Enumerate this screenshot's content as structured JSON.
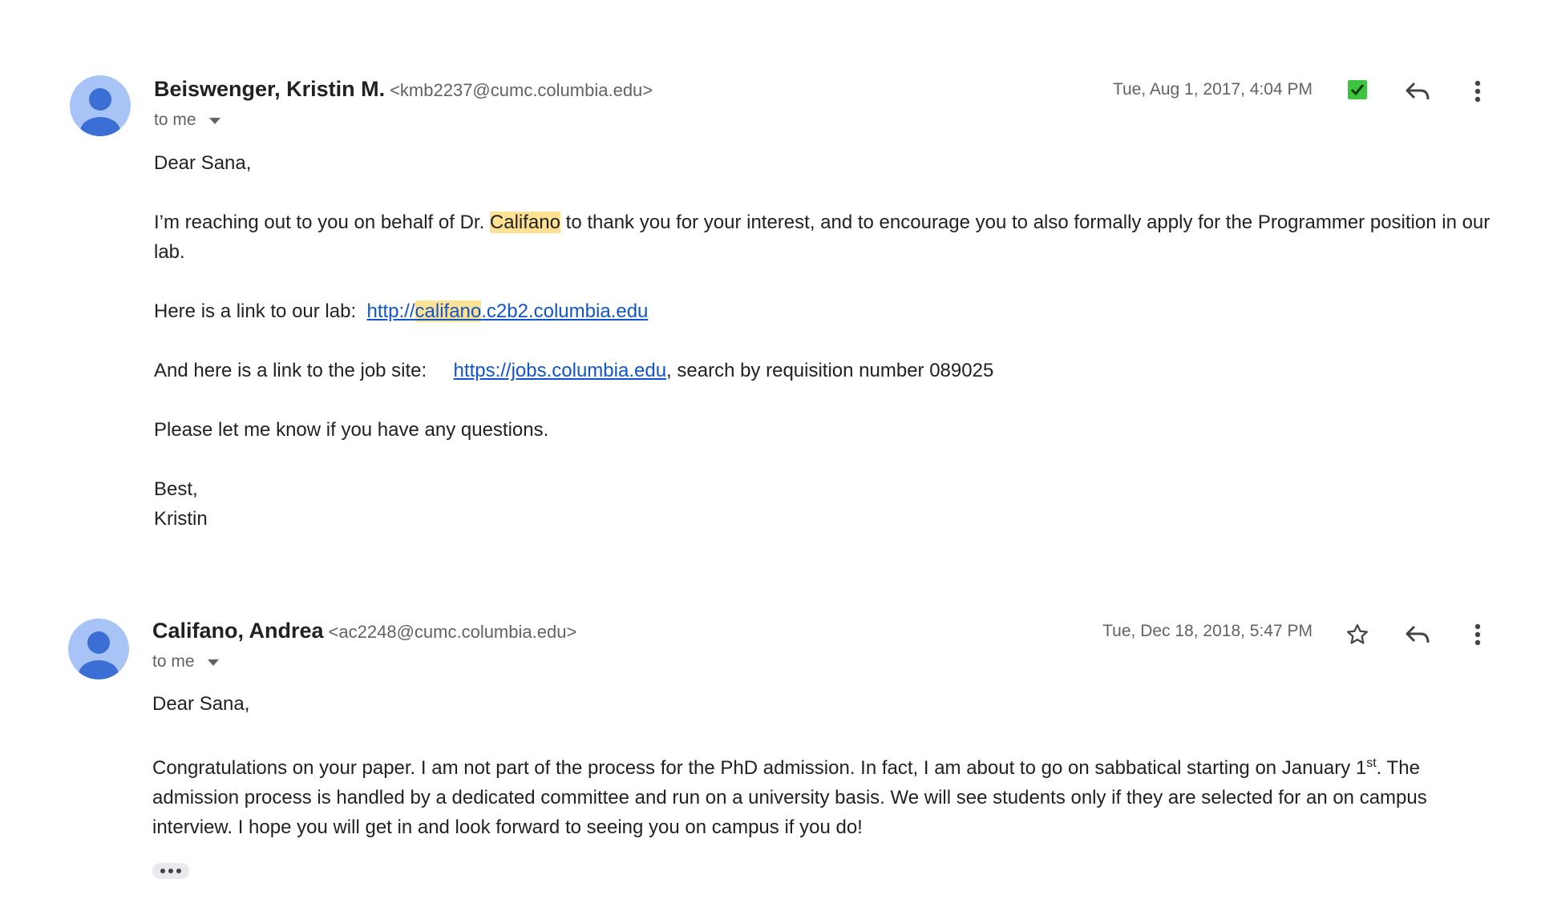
{
  "messages": [
    {
      "sender_name": "Beiswenger, Kristin M.",
      "sender_email": "<kmb2237@cumc.columbia.edu>",
      "recipient": "to me",
      "date": "Tue, Aug 1, 2017, 4:04 PM",
      "status_icon": "green-check-box-icon",
      "greeting": "Dear Sana,",
      "p1_before": "I’m reaching out to you on behalf of Dr.",
      "p1_highlight": "Califano",
      "p1_after": "to thank you for your interest, and to encourage you to also formally apply for the Programmer position in our lab.",
      "lab_label": "Here is a link to our lab:",
      "lab_link_prefix": "http://",
      "lab_link_highlight": "califano",
      "lab_link_suffix": ".c2b2.columbia.edu",
      "job_label": "And here is a link to the job site:",
      "job_link": "https://jobs.columbia.edu",
      "job_after": ", search by requisition number 089025",
      "questions": "Please let me know if you have any questions.",
      "closing": "Best,",
      "signature": "Kristin"
    },
    {
      "sender_name": "Califano, Andrea",
      "sender_email": "<ac2248@cumc.columbia.edu>",
      "recipient": "to me",
      "date": "Tue, Dec 18, 2018, 5:47 PM",
      "status_icon": "star-outline-icon",
      "greeting": "Dear Sana,",
      "p1_before": "Congratulations on your paper. I am not part of the process for the PhD admission. In fact, I am about to go on sabbatical starting on January 1",
      "p1_sup": "st",
      "p1_after": ". The admission process is handled by a dedicated committee and run on a university basis. We will see students only if they are selected for an on campus interview.  I hope you will get in and look forward to seeing you on campus if you do!"
    }
  ],
  "colors": {
    "avatar_bg": "#a8c3f5",
    "avatar_fg": "#3c6fd6",
    "highlight": "#fde293",
    "link": "#1155cc",
    "check_green": "#3ec43e"
  }
}
